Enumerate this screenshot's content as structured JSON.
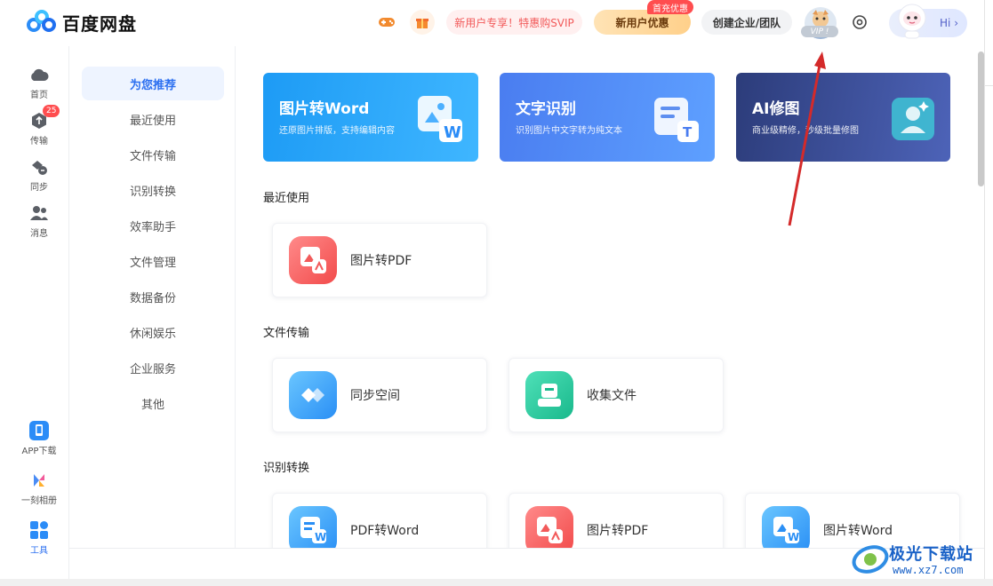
{
  "header": {
    "app_name": "百度网盘",
    "svip_promo": "新用户专享！特惠购SVIP",
    "new_user_offer": "新用户优惠",
    "first_charge_tag": "首充优惠",
    "create_team": "创建企业/团队",
    "vip_label": "VIP",
    "hi_label": "Hi",
    "hi_arrow": "›"
  },
  "rail": {
    "items": [
      {
        "label": "首页",
        "icon": "cloud-icon"
      },
      {
        "label": "传输",
        "icon": "transfer-icon",
        "badge": "25"
      },
      {
        "label": "同步",
        "icon": "sync-icon"
      },
      {
        "label": "消息",
        "icon": "message-icon"
      }
    ],
    "bottom_items": [
      {
        "label": "APP下载",
        "icon": "phone-icon"
      },
      {
        "label": "一刻相册",
        "icon": "album-icon"
      },
      {
        "label": "工具",
        "icon": "tools-icon"
      }
    ]
  },
  "categories": [
    "为您推荐",
    "最近使用",
    "文件传输",
    "识别转换",
    "效率助手",
    "文件管理",
    "数据备份",
    "休闲娱乐",
    "企业服务",
    "其他"
  ],
  "banners": [
    {
      "title": "图片转Word",
      "subtitle": "还原图片排版，支持编辑内容"
    },
    {
      "title": "文字识别",
      "subtitle": "识别图片中文字转为纯文本"
    },
    {
      "title": "AI修图",
      "subtitle": "商业级精修，秒级批量修图"
    }
  ],
  "sections": [
    {
      "title": "最近使用",
      "cards": [
        {
          "label": "图片转PDF",
          "icon": "image-to-pdf-icon"
        }
      ]
    },
    {
      "title": "文件传输",
      "cards": [
        {
          "label": "同步空间",
          "icon": "sync-space-icon"
        },
        {
          "label": "收集文件",
          "icon": "collect-files-icon"
        }
      ]
    },
    {
      "title": "识别转换",
      "cards": [
        {
          "label": "PDF转Word",
          "icon": "pdf-to-word-icon"
        },
        {
          "label": "图片转PDF",
          "icon": "image-to-pdf-icon"
        },
        {
          "label": "图片转Word",
          "icon": "image-to-word-icon"
        }
      ]
    }
  ],
  "watermark": {
    "title": "极光下载站",
    "url": "www.xz7.com"
  },
  "colors": {
    "accent": "#2b6ff0",
    "annotation": "#d42a2a"
  }
}
